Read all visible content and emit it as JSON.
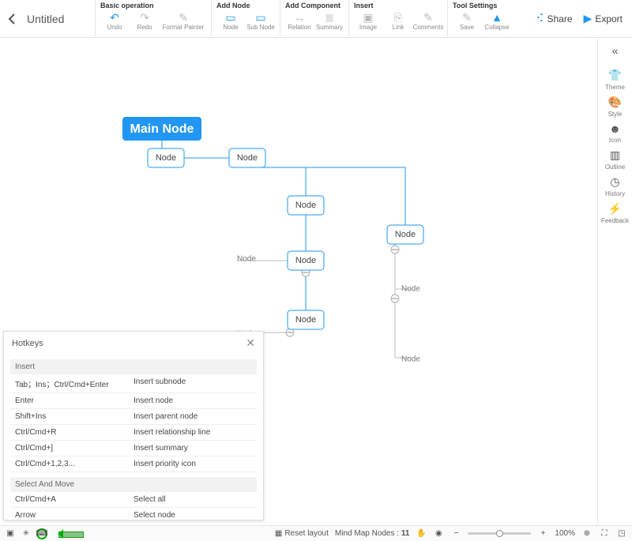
{
  "doc": {
    "title": "Untitled"
  },
  "topActions": {
    "share": "Share",
    "export": "Export"
  },
  "toolbar": {
    "groups": [
      {
        "label": "Basic operation",
        "items": [
          {
            "name": "undo",
            "cap": "Undo",
            "ico": "↶",
            "blue": true
          },
          {
            "name": "redo",
            "cap": "Redo",
            "ico": "↷",
            "blue": false
          },
          {
            "name": "format-painter",
            "cap": "Format Painter",
            "ico": "✎",
            "blue": false,
            "wide": true
          }
        ]
      },
      {
        "label": "Add Node",
        "items": [
          {
            "name": "node",
            "cap": "Node",
            "ico": "▭",
            "blue": true
          },
          {
            "name": "subnode",
            "cap": "Sub Node",
            "ico": "▭",
            "blue": true
          }
        ]
      },
      {
        "label": "Add Component",
        "items": [
          {
            "name": "relation",
            "cap": "Relation",
            "ico": "↔",
            "blue": false
          },
          {
            "name": "summary",
            "cap": "Summary",
            "ico": "≣",
            "blue": false
          }
        ]
      },
      {
        "label": "Insert",
        "items": [
          {
            "name": "image",
            "cap": "Image",
            "ico": "▣",
            "blue": false
          },
          {
            "name": "link",
            "cap": "Link",
            "ico": "⎘",
            "blue": false
          },
          {
            "name": "comments",
            "cap": "Comments",
            "ico": "✎",
            "blue": false
          }
        ]
      },
      {
        "label": "Tool Settings",
        "items": [
          {
            "name": "save",
            "cap": "Save",
            "ico": "✎",
            "blue": false
          },
          {
            "name": "collapse",
            "cap": "Collapse",
            "ico": "▲",
            "blue": true
          }
        ]
      }
    ]
  },
  "sidebar": {
    "items": [
      {
        "name": "theme",
        "cap": "Theme",
        "ico": "👕"
      },
      {
        "name": "style",
        "cap": "Style",
        "ico": "🎨"
      },
      {
        "name": "icon",
        "cap": "Icon",
        "ico": "☻"
      },
      {
        "name": "outline",
        "cap": "Outline",
        "ico": "▥"
      },
      {
        "name": "history",
        "cap": "History",
        "ico": "◷"
      },
      {
        "name": "feedback",
        "cap": "Feedback",
        "ico": "⚡"
      }
    ]
  },
  "diagram": {
    "main": "Main Node",
    "node": "Node"
  },
  "hotkeys": {
    "title": "Hotkeys",
    "sections": [
      {
        "name": "Insert",
        "rows": [
          {
            "k": "Tab；Ins；Ctrl/Cmd+Enter",
            "d": "Insert subnode"
          },
          {
            "k": "Enter",
            "d": "Insert node"
          },
          {
            "k": "Shift+Ins",
            "d": "Insert parent node"
          },
          {
            "k": "Ctrl/Cmd+R",
            "d": "Insert relationship line"
          },
          {
            "k": "Ctrl/Cmd+]",
            "d": "Insert summary"
          },
          {
            "k": "Ctrl/Cmd+1,2,3...",
            "d": "Insert priority icon"
          }
        ]
      },
      {
        "name": "Select And Move",
        "rows": [
          {
            "k": "Ctrl/Cmd+A",
            "d": "Select all"
          },
          {
            "k": "Arrow",
            "d": "Select node"
          }
        ]
      }
    ]
  },
  "status": {
    "reset": "Reset layout",
    "nodesLabel": "Mind Map Nodes :",
    "nodesCount": "11",
    "zoom": "100%"
  }
}
